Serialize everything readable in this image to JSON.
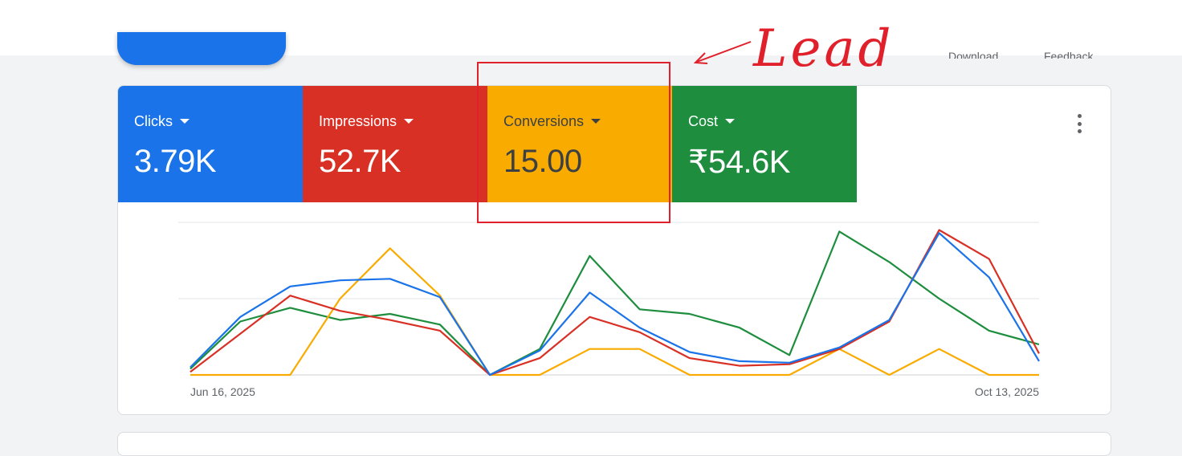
{
  "toolbar": {
    "download_label": "Download",
    "feedback_label": "Feedback"
  },
  "metrics": [
    {
      "label": "Clicks",
      "value": "3.79K",
      "color": "#1a73e8"
    },
    {
      "label": "Impressions",
      "value": "52.7K",
      "color": "#d93025"
    },
    {
      "label": "Conversions",
      "value": "15.00",
      "color": "#f9ab00"
    },
    {
      "label": "Cost",
      "value": "₹54.6K",
      "color": "#1e8e3e"
    }
  ],
  "icons": {
    "metric_dropdown": "caret-down-icon",
    "card_menu": "more-vert-icon"
  },
  "annotation": {
    "text": "Lead",
    "color": "#e0202a"
  },
  "chart_data": {
    "type": "line",
    "x_start_label": "Jun 16, 2025",
    "x_end_label": "Oct 13, 2025",
    "y_scale": "normalized per series",
    "gridlines": 3,
    "series": [
      {
        "name": "Clicks",
        "color": "#1a73e8",
        "values": [
          0.05,
          0.38,
          0.58,
          0.62,
          0.63,
          0.51,
          0.0,
          0.16,
          0.54,
          0.31,
          0.15,
          0.09,
          0.08,
          0.18,
          0.36,
          0.93,
          0.64,
          0.09
        ]
      },
      {
        "name": "Impressions",
        "color": "#d93025",
        "values": [
          0.02,
          0.27,
          0.52,
          0.42,
          0.36,
          0.29,
          0.0,
          0.11,
          0.38,
          0.28,
          0.11,
          0.06,
          0.07,
          0.17,
          0.35,
          0.95,
          0.76,
          0.14
        ]
      },
      {
        "name": "Conversions",
        "color": "#f9ab00",
        "values": [
          0,
          0,
          0,
          0.5,
          0.83,
          0.52,
          0,
          0,
          0.17,
          0.17,
          0,
          0,
          0,
          0.17,
          0,
          0.17,
          0,
          0
        ]
      },
      {
        "name": "Cost",
        "color": "#1e8e3e",
        "values": [
          0.04,
          0.35,
          0.44,
          0.36,
          0.4,
          0.33,
          0.0,
          0.17,
          0.78,
          0.43,
          0.4,
          0.31,
          0.13,
          0.94,
          0.74,
          0.5,
          0.29,
          0.2
        ]
      }
    ]
  }
}
